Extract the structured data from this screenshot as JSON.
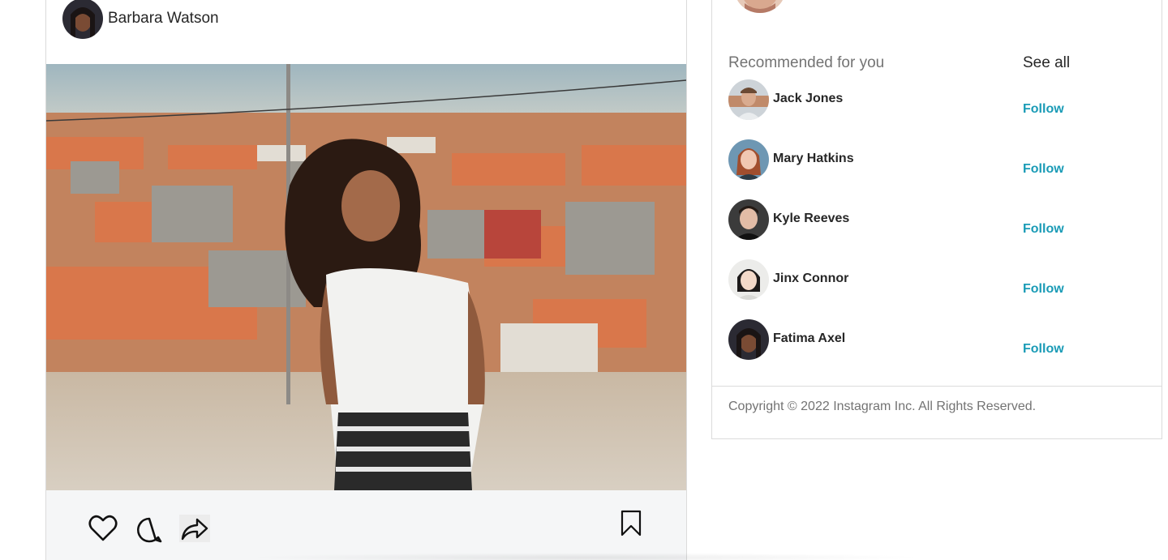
{
  "post": {
    "username": "Barbara Watson",
    "image_description_icon": "photo"
  },
  "sidebar": {
    "title": "Recommended for you",
    "see_all": "See all",
    "suggestions": [
      {
        "name": "Jack Jones",
        "action": "Follow"
      },
      {
        "name": "Mary Hatkins",
        "action": "Follow"
      },
      {
        "name": "Kyle Reeves",
        "action": "Follow"
      },
      {
        "name": "Jinx Connor",
        "action": "Follow"
      },
      {
        "name": "Fatima Axel",
        "action": "Follow"
      }
    ],
    "copyright": "Copyright © 2022 Instagram Inc. All Rights Reserved."
  },
  "colors": {
    "accent": "#1a9bb6",
    "border": "#dbdbdb",
    "muted_text": "#737373",
    "action_bar": "#f5f6f7"
  }
}
